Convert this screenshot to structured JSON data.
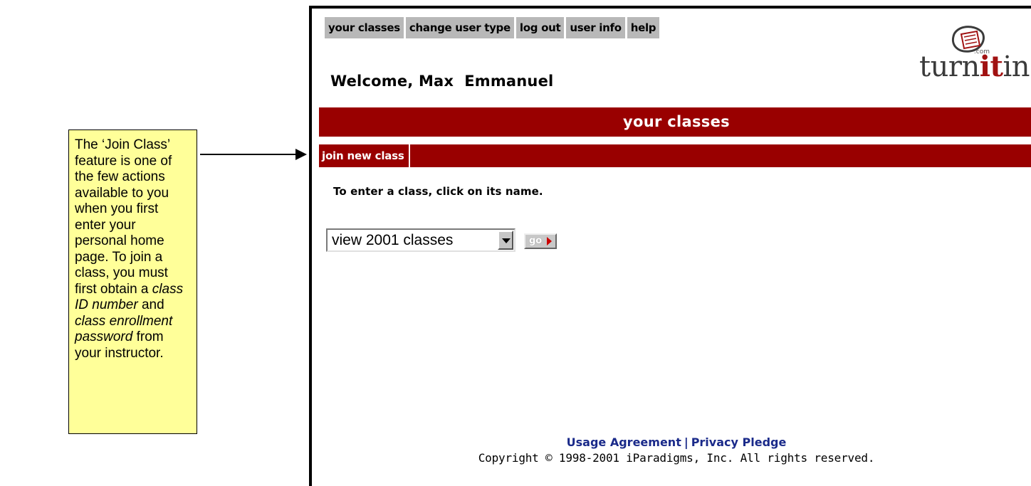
{
  "callout": {
    "line1": "The ‘Join Class’ feature is one of the few actions available to you when you first enter your personal home page.   To join a class, you must first obtain a ",
    "italic1": "class ID number",
    "mid": " and ",
    "italic2": "class enrollment password",
    "end": " from your instructor."
  },
  "nav": {
    "tabs": [
      "your classes",
      "change user type",
      "log out",
      "user info",
      "help"
    ]
  },
  "welcome": {
    "greeting": "Welcome,",
    "name": "Max  Emmanuel"
  },
  "logo": {
    "text_a": "turn",
    "text_b": "it",
    "text_c": "in",
    "dotcom": ".com",
    "icon": "turnitin-logo-icon"
  },
  "header": {
    "title": "your classes"
  },
  "actions": {
    "join_label": "join new class"
  },
  "main": {
    "instruction": "To enter a class, click on its name.",
    "select_value": "view 2001 classes",
    "go_label": "go"
  },
  "footer": {
    "usage_link": "Usage Agreement",
    "separator": "|",
    "privacy_link": "Privacy Pledge",
    "copyright": "Copyright © 1998-2001 iParadigms, Inc. All rights reserved."
  },
  "colors": {
    "brand_red": "#990000",
    "nav_grey": "#b8b8b8",
    "callout_yellow": "#ffff99",
    "link_blue": "#1a2a8a"
  }
}
